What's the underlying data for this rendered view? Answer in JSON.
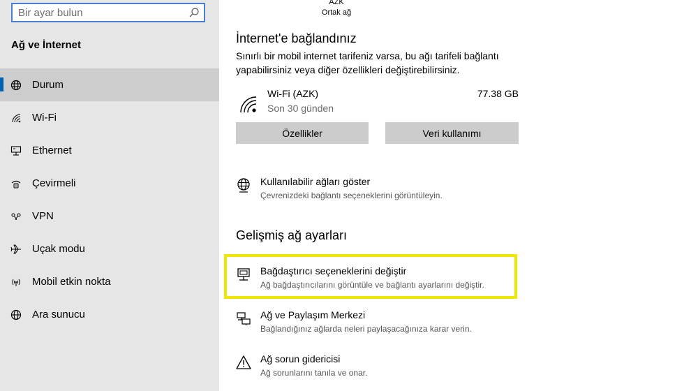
{
  "search": {
    "placeholder": "Bir ayar bulun"
  },
  "sidebar": {
    "title": "Ağ ve İnternet",
    "items": [
      {
        "label": "Durum",
        "icon": "globe-status-icon",
        "active": true
      },
      {
        "label": "Wi-Fi",
        "icon": "wifi-icon",
        "active": false
      },
      {
        "label": "Ethernet",
        "icon": "ethernet-icon",
        "active": false
      },
      {
        "label": "Çevirmeli",
        "icon": "dialup-icon",
        "active": false
      },
      {
        "label": "VPN",
        "icon": "vpn-icon",
        "active": false
      },
      {
        "label": "Uçak modu",
        "icon": "airplane-icon",
        "active": false
      },
      {
        "label": "Mobil etkin nokta",
        "icon": "hotspot-icon",
        "active": false
      },
      {
        "label": "Ara sunucu",
        "icon": "proxy-globe-icon",
        "active": false
      }
    ]
  },
  "network": {
    "name": "AZK",
    "type": "Ortak ağ"
  },
  "status": {
    "heading": "İnternet'e bağlandınız",
    "description": "Sınırlı bir mobil internet tarifeniz varsa, bu ağı tarifeli bağlantı yapabilirsiniz veya diğer özellikleri değiştirebilirsiniz."
  },
  "connection": {
    "name": "Wi-Fi (AZK)",
    "period": "Son 30 günden",
    "usage": "77.38 GB"
  },
  "buttons": {
    "properties": "Özellikler",
    "data_usage": "Veri kullanımı"
  },
  "show_networks": {
    "title": "Kullanılabilir ağları göster",
    "subtitle": "Çevrenizdeki bağlantı seçeneklerini görüntüleyin."
  },
  "advanced": {
    "heading": "Gelişmiş ağ ayarları",
    "items": [
      {
        "title": "Bağdaştırıcı seçeneklerini değiştir",
        "subtitle": "Ağ bağdaştırıcılarını görüntüle ve bağlantı ayarlarını değiştir.",
        "icon": "adapter-icon"
      },
      {
        "title": "Ağ ve Paylaşım Merkezi",
        "subtitle": "Bağlandığınız ağlarda neleri paylaşacağınıza karar verin.",
        "icon": "sharing-center-icon"
      },
      {
        "title": "Ağ sorun gidericisi",
        "subtitle": "Ağ sorunlarını tanıla ve onar.",
        "icon": "warning-icon"
      }
    ]
  },
  "colors": {
    "accent": "#0063b1",
    "highlight": "#f2e600",
    "sidebar_bg": "#e6e6e6",
    "button_bg": "#cccccc"
  }
}
